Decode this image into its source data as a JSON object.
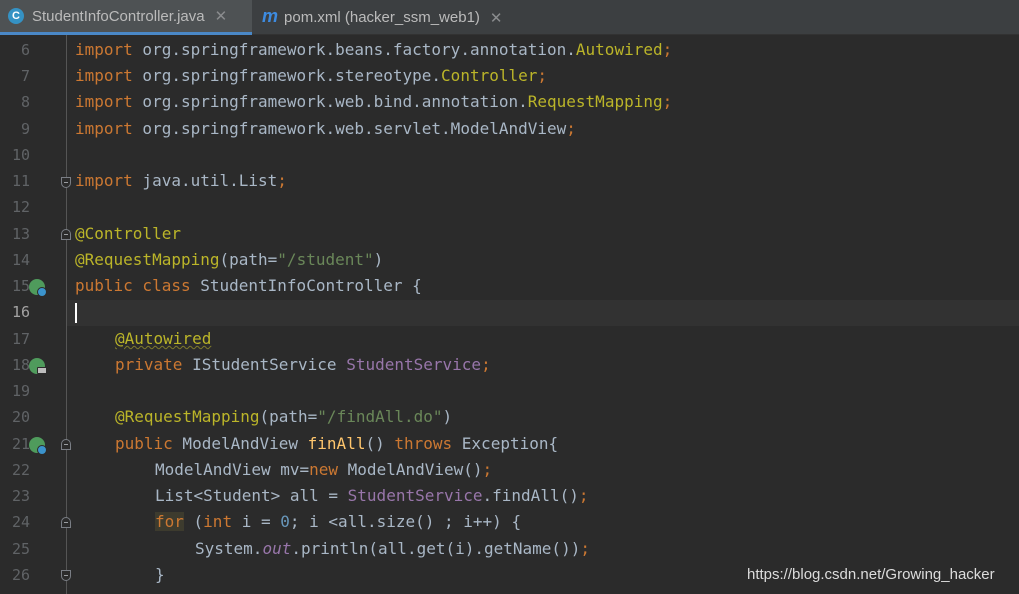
{
  "tabs": [
    {
      "label": "StudentInfoController.java",
      "icon": "c-class-icon",
      "active": true
    },
    {
      "label": "pom.xml (hacker_ssm_web1)",
      "icon": "maven-m-icon",
      "active": false
    }
  ],
  "line_numbers": [
    "6",
    "7",
    "8",
    "9",
    "10",
    "11",
    "12",
    "13",
    "14",
    "15",
    "16",
    "17",
    "18",
    "19",
    "20",
    "21",
    "22",
    "23",
    "24",
    "25",
    "26"
  ],
  "code": {
    "l6": {
      "kw": "import",
      "pkg": " org.springframework.beans.factory.annotation.",
      "cls": "Autowired",
      "semi": ";"
    },
    "l7": {
      "kw": "import",
      "pkg": " org.springframework.stereotype.",
      "cls": "Controller",
      "semi": ";"
    },
    "l8": {
      "kw": "import",
      "pkg": " org.springframework.web.bind.annotation.",
      "cls": "RequestMapping",
      "semi": ";"
    },
    "l9": {
      "kw": "import",
      "pkg": " org.springframework.web.servlet.ModelAndView",
      "semi": ";"
    },
    "l11": {
      "kw": "import",
      "pkg": " java.util.List",
      "semi": ";"
    },
    "l13": {
      "ann": "@Controller"
    },
    "l14": {
      "ann": "@RequestMapping",
      "p1": "(path=",
      "str": "\"/student\"",
      "p2": ")"
    },
    "l15": {
      "kw": "public class",
      "rest": " StudentInfoController {"
    },
    "l17": {
      "ann": "@Autowired"
    },
    "l18": {
      "kw": "private",
      "type": " IStudentService ",
      "field": "StudentService",
      "semi": ";"
    },
    "l20": {
      "ann": "@RequestMapping",
      "p1": "(path=",
      "str": "\"/findAll.do\"",
      "p2": ")"
    },
    "l21": {
      "kw": "public",
      "type": " ModelAndView ",
      "method": "finAll",
      "p": "() ",
      "kw2": "throws",
      "rest": " Exception{"
    },
    "l22": {
      "a": "ModelAndView mv=",
      "kw": "new",
      "b": " ModelAndView()",
      "semi": ";"
    },
    "l23": {
      "a": "List<Student> all = ",
      "field": "StudentService",
      "b": ".findAll()",
      "semi": ";"
    },
    "l24": {
      "kw": "for",
      "a": " (",
      "kw2": "int",
      "b": " i = ",
      "num": "0",
      "c": "; i <all.size() ; i++) {"
    },
    "l25": {
      "a": "System.",
      "static": "out",
      "b": ".println(all.get(i).getName())",
      "semi": ";"
    },
    "l26": {
      "a": "}"
    }
  },
  "watermark": "https://blog.csdn.net/Growing_hacker",
  "colors": {
    "background": "#2b2b2b",
    "keyword": "#cc7832",
    "annotation": "#bbb529",
    "string": "#6a8759",
    "field": "#9876aa",
    "method": "#ffc66d",
    "text": "#a9b7c6"
  }
}
